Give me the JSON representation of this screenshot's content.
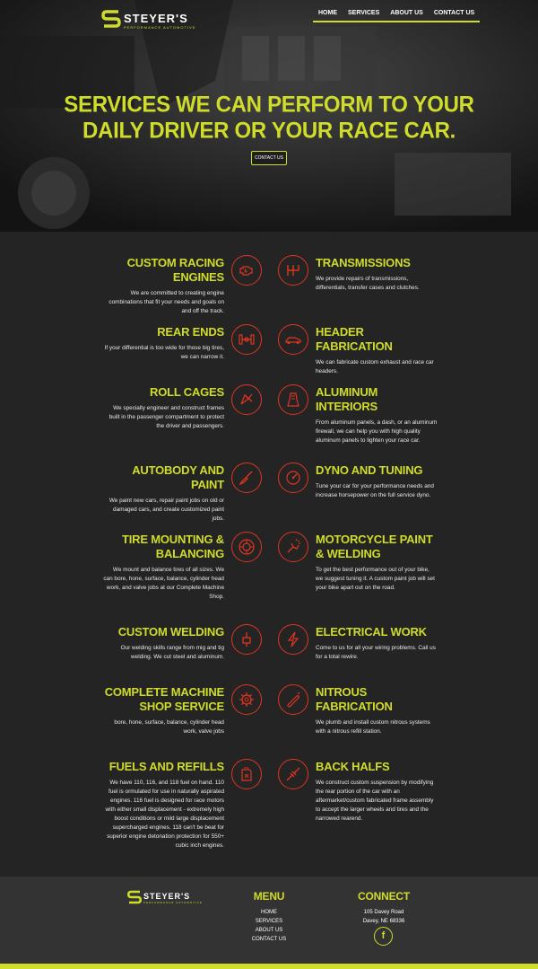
{
  "brand": {
    "name": "STEYER'S",
    "tagline": "PERFORMANCE AUTOMOTIVE"
  },
  "nav": {
    "items": [
      "HOME",
      "SERVICES",
      "ABOUT US",
      "CONTACT US"
    ]
  },
  "hero": {
    "title_line1": "SERVICES WE CAN PERFORM TO YOUR",
    "title_line2": "DAILY DRIVER OR YOUR RACE CAR.",
    "button": "CONTACT US"
  },
  "services": {
    "left": [
      {
        "title": "CUSTOM RACING ENGINES",
        "text": "We are committed to creating engine combinations that fit your needs and goals on and off the track.",
        "icon": "engine-icon"
      },
      {
        "title": "REAR ENDS",
        "text": "If your differential is too wide for those big tires, we can narrow it.",
        "icon": "axle-icon"
      },
      {
        "title": "ROLL CAGES",
        "text": "We specially engineer and construct frames built in the passenger compartment to protect the driver and passengers.",
        "icon": "roll-cage-icon"
      },
      {
        "title": "AUTOBODY AND PAINT",
        "text": "We paint new cars, repair paint jobs on old or damaged cars, and create customized paint jobs.",
        "icon": "paint-brush-icon"
      },
      {
        "title": "TIRE MOUNTING & BALANCING",
        "text": "We mount and balance tires of all sizes. We can bore, hone, surface, balance, cylinder head work, and valve jobs at our Complete Machine Shop.",
        "icon": "tire-icon"
      },
      {
        "title": "CUSTOM WELDING",
        "text": "Our welding skills range from mig and tig welding. We cut steel and aluminum.",
        "icon": "welding-icon"
      },
      {
        "title": "COMPLETE MACHINE SHOP SERVICE",
        "text": "bore, hone, surface, balance, cylinder head work, valve jobs",
        "icon": "gear-icon"
      },
      {
        "title": "FUELS AND REFILLS",
        "text": "We have 110, 116, and 118 fuel on hand. 110 fuel is ormulated for use in naturally aspirated engines. 116 fuel is designed for race motors with either small displacement - extremely high boost conditions or mild large displacement supercharged engines. 118 can't be beat for superior engine detonation protection for 550+ cubic inch engines.",
        "icon": "fuel-can-icon"
      }
    ],
    "right": [
      {
        "title": "TRANSMISSIONS",
        "text": "We provide repairs of transmissions, differentials, transfer cases and clutches.",
        "icon": "gear-shift-icon"
      },
      {
        "title": "HEADER FABRICATION",
        "text": "We can fabricate custom exhaust and race car headers.",
        "icon": "race-car-icon"
      },
      {
        "title": "ALUMINUM INTERIORS",
        "text": "From aluminum panels, a dash, or an aluminum firewall, we can help you with high quality aluminum panels to lighten your race car.",
        "icon": "seat-icon"
      },
      {
        "title": "DYNO AND TUNING",
        "text": "Tune your car for your performance needs and increase horsepower on the full service dyno.",
        "icon": "speedometer-icon"
      },
      {
        "title": "MOTORCYCLE PAINT & WELDING",
        "text": "To get the best performance out of your bike, we suggest tuning it. A custom paint job will set your bike apart out on the road.",
        "icon": "spray-gun-icon"
      },
      {
        "title": "ELECTRICAL WORK",
        "text": "Come to us for all your wiring problems. Call us for a total rewire.",
        "icon": "lightning-icon"
      },
      {
        "title": "NITROUS FABRICATION",
        "text": "We plumb and install custom nitrous systems with a nitrous refill station.",
        "icon": "nitrous-bottle-icon"
      },
      {
        "title": "BACK HALFS",
        "text": "We construct custom suspension by modifying the rear portion of the car with an aftermarket/custom fabricated frame assembly to accept the larger wheels and tires and the narrowed rearend.",
        "icon": "suspension-icon"
      }
    ]
  },
  "footer": {
    "menu_title": "MENU",
    "menu_items": [
      "HOME",
      "SERVICES",
      "ABOUT US",
      "CONTACT US"
    ],
    "connect_title": "CONNECT",
    "address_line1": "105 Davey Road",
    "address_line2": "Davey, NE 68336",
    "facebook": "f"
  },
  "colors": {
    "accent": "#cfdc2a",
    "icon": "#e0351f",
    "background": "#242424",
    "footer": "#333333"
  }
}
